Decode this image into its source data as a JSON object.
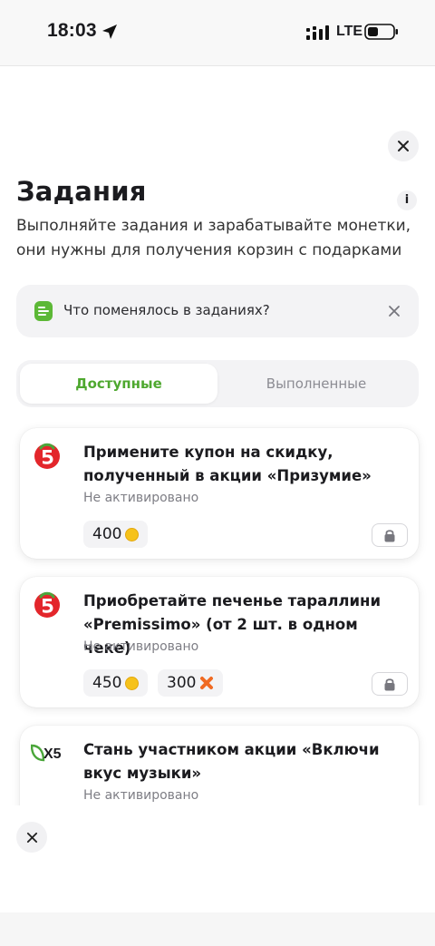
{
  "status_bar": {
    "time": "18:03",
    "network": "LTE"
  },
  "page": {
    "title": "Задания",
    "info_label": "i",
    "subtitle": "Выполняйте задания и зарабатывайте монетки, они нужны для получения корзин с подарками"
  },
  "notice": {
    "text": "Что поменялось в заданиях?"
  },
  "tabs": [
    {
      "label": "Доступные",
      "active": true
    },
    {
      "label": "Выполненные",
      "active": false
    }
  ],
  "tasks": [
    {
      "logo": "pyaterochka-logo",
      "title": "Примените купон на скидку, полученный в акции «Призумие»",
      "status": "Не активировано",
      "rewards": [
        {
          "value": "400",
          "icon": "coin-icon"
        }
      ],
      "locked": true
    },
    {
      "logo": "pyaterochka-logo",
      "title": "Приобретайте печенье тараллини «Premissimo» (от 2 шт. в одном чеке)",
      "status": "Не активировано",
      "rewards": [
        {
          "value": "450",
          "icon": "coin-icon"
        },
        {
          "value": "300",
          "icon": "x-points-icon"
        }
      ],
      "locked": true
    },
    {
      "logo": "x5-logo",
      "logo_text": "X5",
      "title": "Стань участником акции «Включи вкус музыки»",
      "status": "Не активировано"
    }
  ],
  "colors": {
    "accent_green": "#4ea82f",
    "coin": "#f6c21b",
    "x_points": "#f06a22",
    "brand_red": "#e3262b"
  }
}
